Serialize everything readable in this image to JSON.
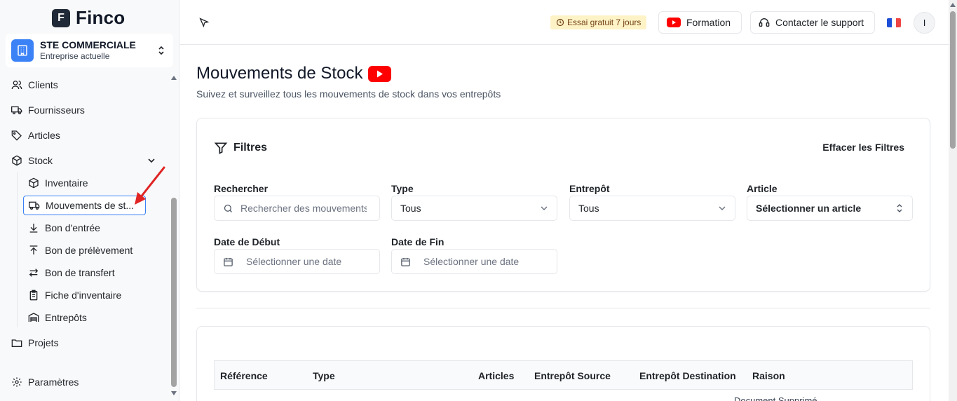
{
  "app": {
    "name": "Finco",
    "logo_letter": "F"
  },
  "company": {
    "name": "STE COMMERCIALE",
    "subtitle": "Entreprise actuelle"
  },
  "sidebar": {
    "items": [
      {
        "label": "Clients",
        "icon": "users-icon"
      },
      {
        "label": "Fournisseurs",
        "icon": "truck-icon"
      },
      {
        "label": "Articles",
        "icon": "tag-icon"
      },
      {
        "label": "Stock",
        "icon": "package-icon",
        "expanded": true
      },
      {
        "label": "Projets",
        "icon": "folder-icon"
      },
      {
        "label": "Paramètres",
        "icon": "gear-icon"
      }
    ],
    "stock_sub": [
      {
        "label": "Inventaire",
        "icon": "package-icon"
      },
      {
        "label": "Mouvements de st...",
        "icon": "truck-icon",
        "active": true
      },
      {
        "label": "Bon d'entrée",
        "icon": "arrow-down-icon"
      },
      {
        "label": "Bon de prélèvement",
        "icon": "arrow-up-icon"
      },
      {
        "label": "Bon de transfert",
        "icon": "transfer-icon"
      },
      {
        "label": "Fiche d'inventaire",
        "icon": "clipboard-icon"
      },
      {
        "label": "Entrepôts",
        "icon": "warehouse-icon"
      }
    ]
  },
  "header": {
    "trial_badge": "Essai gratuit 7 jours",
    "training_label": "Formation",
    "support_label": "Contacter le support",
    "avatar_initial": "I"
  },
  "page": {
    "title": "Mouvements de Stock",
    "subtitle": "Suivez et surveillez tous les mouvements de stock dans vos entrepôts"
  },
  "filters": {
    "title": "Filtres",
    "clear_label": "Effacer les Filtres",
    "search": {
      "label": "Rechercher",
      "placeholder": "Rechercher des mouvements..."
    },
    "type": {
      "label": "Type",
      "value": "Tous"
    },
    "warehouse": {
      "label": "Entrepôt",
      "value": "Tous"
    },
    "article": {
      "label": "Article",
      "value": "Sélectionner un article"
    },
    "start_date": {
      "label": "Date de Début",
      "placeholder": "Sélectionner une date"
    },
    "end_date": {
      "label": "Date de Fin",
      "placeholder": "Sélectionner une date"
    }
  },
  "table": {
    "columns": [
      "Référence",
      "Type",
      "Articles",
      "Entrepôt Source",
      "Entrepôt Destination",
      "Raison"
    ],
    "peek_text": "Document Supprimé"
  },
  "colors": {
    "accent": "#3b82f6",
    "youtube": "#ff0000",
    "trial_bg": "#fef3c7",
    "annotation_arrow": "#e02424"
  }
}
